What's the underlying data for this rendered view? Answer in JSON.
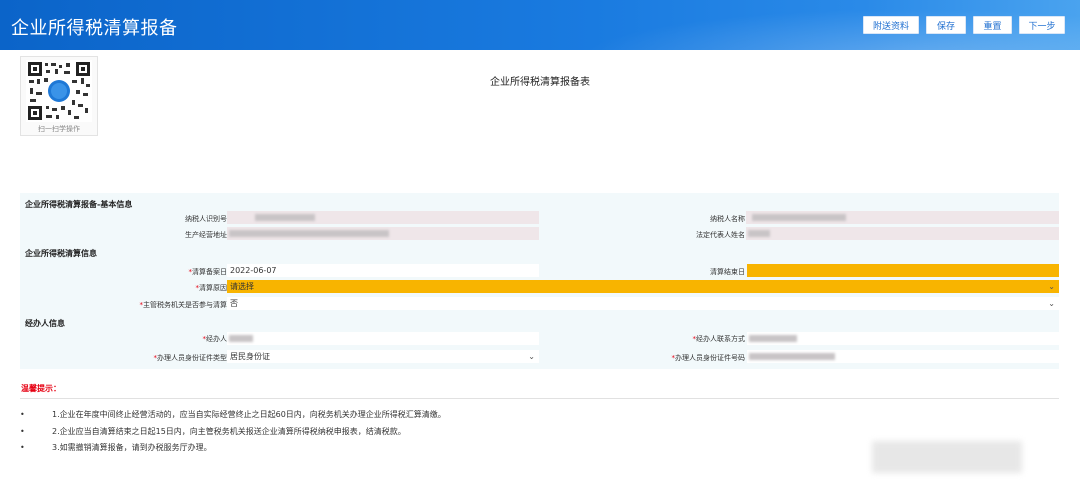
{
  "header": {
    "title": "企业所得税清算报备",
    "buttons": [
      "附送资料",
      "保存",
      "重置",
      "下一步"
    ]
  },
  "qr": {
    "caption": "扫一扫学操作"
  },
  "document_title": "企业所得税清算报备表",
  "sections": {
    "basic": "企业所得税清算报备-基本信息",
    "liquidation": "企业所得税清算信息",
    "agent": "经办人信息"
  },
  "basic": {
    "taxpayer_id_label": "纳税人识别号",
    "taxpayer_name_label": "纳税人名称",
    "address_label": "生产经营地址",
    "legal_rep_label": "法定代表人姓名"
  },
  "liquidation": {
    "start_date_label": "清算备案日",
    "start_date_value": "2022-06-07",
    "end_date_label": "清算结束日",
    "end_date_value": "",
    "reason_label": "清算原因",
    "reason_value": "请选择",
    "tax_authority_label": "主管税务机关是否参与清算",
    "tax_authority_value": "否"
  },
  "agent": {
    "name_label": "经办人",
    "phone_label": "经办人联系方式",
    "id_type_label": "办理人员身份证件类型",
    "id_type_value": "居民身份证",
    "id_number_label": "办理人员身份证件号码"
  },
  "tips": {
    "title": "温馨提示：",
    "items": [
      "1.企业在年度中间终止经营活动的，应当自实际经营终止之日起60日内，向税务机关办理企业所得税汇算清缴。",
      "2.企业应当自清算结束之日起15日内，向主管税务机关报送企业清算所得税纳税申报表，结清税款。",
      "3.如需撤销清算报备，请到办税服务厅办理。"
    ]
  },
  "icons": {
    "required": "*",
    "bullet": "•",
    "dropdown": "chevron-down-icon"
  },
  "colors": {
    "header": "#0b64c9",
    "highlight": "#f8b400",
    "required": "#e60012"
  }
}
